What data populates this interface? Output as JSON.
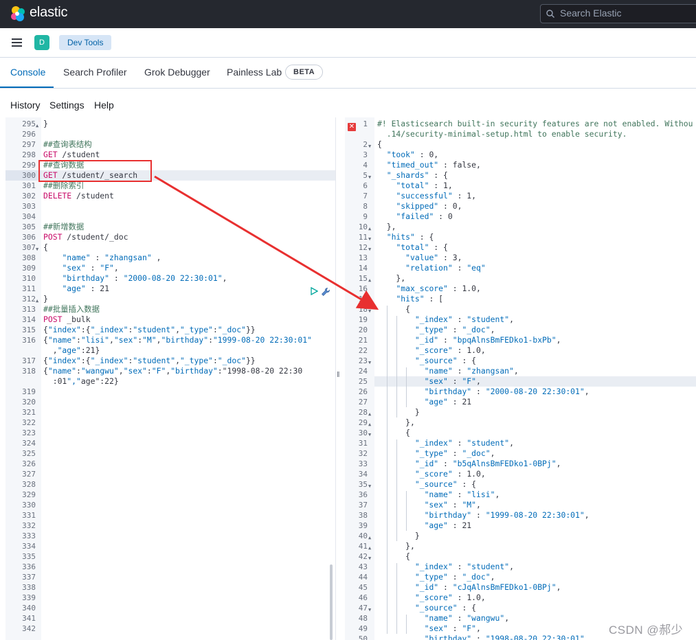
{
  "topbar": {
    "brand": "elastic",
    "search_placeholder": "Search Elastic"
  },
  "subbar": {
    "avatar_letter": "D",
    "breadcrumb": "Dev Tools"
  },
  "tabs": [
    {
      "label": "Console",
      "active": true
    },
    {
      "label": "Search Profiler",
      "active": false
    },
    {
      "label": "Grok Debugger",
      "active": false
    },
    {
      "label": "Painless Lab",
      "active": false
    }
  ],
  "beta_badge": "BETA",
  "menu": {
    "history": "History",
    "settings": "Settings",
    "help": "Help"
  },
  "editor": {
    "highlighted_line": "300",
    "lines": [
      {
        "n": "295",
        "fold": "▲",
        "t": "}",
        "c": ""
      },
      {
        "n": "296",
        "fold": "",
        "t": "",
        "c": ""
      },
      {
        "n": "297",
        "fold": "",
        "t": "##查询表结构",
        "c": "cmt"
      },
      {
        "n": "298",
        "fold": "",
        "t": "GET /student",
        "c": "req"
      },
      {
        "n": "299",
        "fold": "",
        "t": "##查询数据",
        "c": "cmt"
      },
      {
        "n": "300",
        "fold": "",
        "t": "GET /student/_search",
        "c": "req"
      },
      {
        "n": "301",
        "fold": "",
        "t": "##删除索引",
        "c": "cmt"
      },
      {
        "n": "302",
        "fold": "",
        "t": "DELETE /student",
        "c": "req"
      },
      {
        "n": "303",
        "fold": "",
        "t": "",
        "c": ""
      },
      {
        "n": "304",
        "fold": "",
        "t": "",
        "c": ""
      },
      {
        "n": "305",
        "fold": "",
        "t": "##新增数据",
        "c": "cmt"
      },
      {
        "n": "306",
        "fold": "",
        "t": "POST /student/_doc",
        "c": "req"
      },
      {
        "n": "307",
        "fold": "▼",
        "t": "{",
        "c": ""
      },
      {
        "n": "308",
        "fold": "",
        "t": "    \"name\" : \"zhangsan\" ,",
        "c": "kv"
      },
      {
        "n": "309",
        "fold": "",
        "t": "    \"sex\" : \"F\",",
        "c": "kv"
      },
      {
        "n": "310",
        "fold": "",
        "t": "    \"birthday\" : \"2000-08-20 22:30:01\",",
        "c": "kv"
      },
      {
        "n": "311",
        "fold": "",
        "t": "    \"age\" : 21",
        "c": "kv"
      },
      {
        "n": "312",
        "fold": "▲",
        "t": "}",
        "c": ""
      },
      {
        "n": "313",
        "fold": "",
        "t": "##批量插入数据",
        "c": "cmt"
      },
      {
        "n": "314",
        "fold": "",
        "t": "POST _bulk",
        "c": "req"
      },
      {
        "n": "315",
        "fold": "",
        "t": "{\"index\":{\"_index\":\"student\",\"_type\":\"_doc\"}}",
        "c": "kv"
      },
      {
        "n": "316",
        "fold": "",
        "t": "{\"name\":\"lisi\",\"sex\":\"M\",\"birthday\":\"1999-08-20 22:30:01\"",
        "c": "kv"
      },
      {
        "n": "",
        "fold": "",
        "t": "  ,\"age\":21}",
        "c": "kv"
      },
      {
        "n": "317",
        "fold": "",
        "t": "{\"index\":{\"_index\":\"student\",\"_type\":\"_doc\"}}",
        "c": "kv"
      },
      {
        "n": "318",
        "fold": "",
        "t": "{\"name\":\"wangwu\",\"sex\":\"F\",\"birthday\":\"1998-08-20 22:30",
        "c": "kv"
      },
      {
        "n": "",
        "fold": "",
        "t": "  :01\",\"age\":22}",
        "c": "kv"
      },
      {
        "n": "319",
        "fold": "",
        "t": "",
        "c": ""
      },
      {
        "n": "320",
        "fold": "",
        "t": "",
        "c": ""
      },
      {
        "n": "321",
        "fold": "",
        "t": "",
        "c": ""
      },
      {
        "n": "322",
        "fold": "",
        "t": "",
        "c": ""
      },
      {
        "n": "323",
        "fold": "",
        "t": "",
        "c": ""
      },
      {
        "n": "324",
        "fold": "",
        "t": "",
        "c": ""
      },
      {
        "n": "325",
        "fold": "",
        "t": "",
        "c": ""
      },
      {
        "n": "326",
        "fold": "",
        "t": "",
        "c": ""
      },
      {
        "n": "327",
        "fold": "",
        "t": "",
        "c": ""
      },
      {
        "n": "328",
        "fold": "",
        "t": "",
        "c": ""
      },
      {
        "n": "329",
        "fold": "",
        "t": "",
        "c": ""
      },
      {
        "n": "330",
        "fold": "",
        "t": "",
        "c": ""
      },
      {
        "n": "331",
        "fold": "",
        "t": "",
        "c": ""
      },
      {
        "n": "332",
        "fold": "",
        "t": "",
        "c": ""
      },
      {
        "n": "333",
        "fold": "",
        "t": "",
        "c": ""
      },
      {
        "n": "334",
        "fold": "",
        "t": "",
        "c": ""
      },
      {
        "n": "335",
        "fold": "",
        "t": "",
        "c": ""
      },
      {
        "n": "336",
        "fold": "",
        "t": "",
        "c": ""
      },
      {
        "n": "337",
        "fold": "",
        "t": "",
        "c": ""
      },
      {
        "n": "338",
        "fold": "",
        "t": "",
        "c": ""
      },
      {
        "n": "339",
        "fold": "",
        "t": "",
        "c": ""
      },
      {
        "n": "340",
        "fold": "",
        "t": "",
        "c": ""
      },
      {
        "n": "341",
        "fold": "",
        "t": "",
        "c": ""
      },
      {
        "n": "342",
        "fold": "",
        "t": "",
        "c": ""
      }
    ]
  },
  "output": {
    "highlighted_line": "25",
    "lines": [
      {
        "n": "1",
        "fold": "",
        "t": "#! Elasticsearch built-in security features are not enabled. Withou",
        "c": "cmt"
      },
      {
        "n": "",
        "fold": "",
        "t": "  .14/security-minimal-setup.html to enable security.",
        "c": "cmt"
      },
      {
        "n": "2",
        "fold": "▼",
        "t": "{",
        "c": ""
      },
      {
        "n": "3",
        "fold": "",
        "t": "  \"took\" : 0,",
        "c": "kv"
      },
      {
        "n": "4",
        "fold": "",
        "t": "  \"timed_out\" : false,",
        "c": "kv"
      },
      {
        "n": "5",
        "fold": "▼",
        "t": "  \"_shards\" : {",
        "c": "kv"
      },
      {
        "n": "6",
        "fold": "",
        "t": "    \"total\" : 1,",
        "c": "kv"
      },
      {
        "n": "7",
        "fold": "",
        "t": "    \"successful\" : 1,",
        "c": "kv"
      },
      {
        "n": "8",
        "fold": "",
        "t": "    \"skipped\" : 0,",
        "c": "kv"
      },
      {
        "n": "9",
        "fold": "",
        "t": "    \"failed\" : 0",
        "c": "kv"
      },
      {
        "n": "10",
        "fold": "▲",
        "t": "  },",
        "c": ""
      },
      {
        "n": "11",
        "fold": "▼",
        "t": "  \"hits\" : {",
        "c": "kv"
      },
      {
        "n": "12",
        "fold": "▼",
        "t": "    \"total\" : {",
        "c": "kv"
      },
      {
        "n": "13",
        "fold": "",
        "t": "      \"value\" : 3,",
        "c": "kv"
      },
      {
        "n": "14",
        "fold": "",
        "t": "      \"relation\" : \"eq\"",
        "c": "kv"
      },
      {
        "n": "15",
        "fold": "▲",
        "t": "    },",
        "c": ""
      },
      {
        "n": "16",
        "fold": "",
        "t": "    \"max_score\" : 1.0,",
        "c": "kv"
      },
      {
        "n": "17",
        "fold": "▼",
        "t": "    \"hits\" : [",
        "c": "kv"
      },
      {
        "n": "18",
        "fold": "▼",
        "t": "      {",
        "c": ""
      },
      {
        "n": "19",
        "fold": "",
        "t": "        \"_index\" : \"student\",",
        "c": "kv"
      },
      {
        "n": "20",
        "fold": "",
        "t": "        \"_type\" : \"_doc\",",
        "c": "kv"
      },
      {
        "n": "21",
        "fold": "",
        "t": "        \"_id\" : \"bpqAlnsBmFEDko1-bxPb\",",
        "c": "kv"
      },
      {
        "n": "22",
        "fold": "",
        "t": "        \"_score\" : 1.0,",
        "c": "kv"
      },
      {
        "n": "23",
        "fold": "▼",
        "t": "        \"_source\" : {",
        "c": "kv"
      },
      {
        "n": "24",
        "fold": "",
        "t": "          \"name\" : \"zhangsan\",",
        "c": "kv"
      },
      {
        "n": "25",
        "fold": "",
        "t": "          \"sex\" : \"F\",",
        "c": "kv"
      },
      {
        "n": "26",
        "fold": "",
        "t": "          \"birthday\" : \"2000-08-20 22:30:01\",",
        "c": "kv"
      },
      {
        "n": "27",
        "fold": "",
        "t": "          \"age\" : 21",
        "c": "kv"
      },
      {
        "n": "28",
        "fold": "▲",
        "t": "        }",
        "c": ""
      },
      {
        "n": "29",
        "fold": "▲",
        "t": "      },",
        "c": ""
      },
      {
        "n": "30",
        "fold": "▼",
        "t": "      {",
        "c": ""
      },
      {
        "n": "31",
        "fold": "",
        "t": "        \"_index\" : \"student\",",
        "c": "kv"
      },
      {
        "n": "32",
        "fold": "",
        "t": "        \"_type\" : \"_doc\",",
        "c": "kv"
      },
      {
        "n": "33",
        "fold": "",
        "t": "        \"_id\" : \"b5qAlnsBmFEDko1-0BPj\",",
        "c": "kv"
      },
      {
        "n": "34",
        "fold": "",
        "t": "        \"_score\" : 1.0,",
        "c": "kv"
      },
      {
        "n": "35",
        "fold": "▼",
        "t": "        \"_source\" : {",
        "c": "kv"
      },
      {
        "n": "36",
        "fold": "",
        "t": "          \"name\" : \"lisi\",",
        "c": "kv"
      },
      {
        "n": "37",
        "fold": "",
        "t": "          \"sex\" : \"M\",",
        "c": "kv"
      },
      {
        "n": "38",
        "fold": "",
        "t": "          \"birthday\" : \"1999-08-20 22:30:01\",",
        "c": "kv"
      },
      {
        "n": "39",
        "fold": "",
        "t": "          \"age\" : 21",
        "c": "kv"
      },
      {
        "n": "40",
        "fold": "▲",
        "t": "        }",
        "c": ""
      },
      {
        "n": "41",
        "fold": "▲",
        "t": "      },",
        "c": ""
      },
      {
        "n": "42",
        "fold": "▼",
        "t": "      {",
        "c": ""
      },
      {
        "n": "43",
        "fold": "",
        "t": "        \"_index\" : \"student\",",
        "c": "kv"
      },
      {
        "n": "44",
        "fold": "",
        "t": "        \"_type\" : \"_doc\",",
        "c": "kv"
      },
      {
        "n": "45",
        "fold": "",
        "t": "        \"_id\" : \"cJqAlnsBmFEDko1-0BPj\",",
        "c": "kv"
      },
      {
        "n": "46",
        "fold": "",
        "t": "        \"_score\" : 1.0,",
        "c": "kv"
      },
      {
        "n": "47",
        "fold": "▼",
        "t": "        \"_source\" : {",
        "c": "kv"
      },
      {
        "n": "48",
        "fold": "",
        "t": "          \"name\" : \"wangwu\",",
        "c": "kv"
      },
      {
        "n": "49",
        "fold": "",
        "t": "          \"sex\" : \"F\",",
        "c": "kv"
      },
      {
        "n": "50",
        "fold": "",
        "t": "          \"birthday\" : \"1998-08-20 22:30:01\",",
        "c": "kv"
      }
    ]
  },
  "watermark": "CSDN @郝少",
  "colors": {
    "topbar": "#25282f",
    "accent": "#006bb8",
    "annotation_red": "#e83030",
    "verb": "#c80a68"
  }
}
